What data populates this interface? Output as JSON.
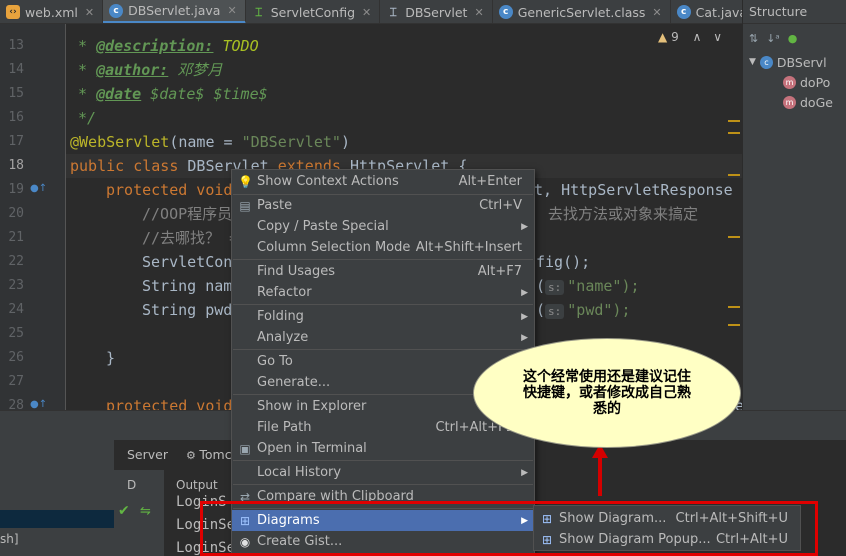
{
  "tabs": [
    {
      "label": "web.xml",
      "icon": "xml-file-icon"
    },
    {
      "label": "DBServlet.java",
      "icon": "java-class-icon",
      "active": true
    },
    {
      "label": "ServletConfig",
      "icon": "interface-icon"
    },
    {
      "label": "DBServlet",
      "icon": "class-icon"
    },
    {
      "label": "GenericServlet.class",
      "icon": "class-file-icon"
    },
    {
      "label": "Cat.java",
      "icon": "java-class-icon"
    }
  ],
  "structure": {
    "title": "Structure",
    "items": [
      "DBServl",
      "doPo",
      "doGe"
    ]
  },
  "editor": {
    "line_numbers": [
      "13",
      "14",
      "15",
      "16",
      "17",
      "18",
      "19",
      "20",
      "21",
      "22",
      "23",
      "24",
      "25",
      "26",
      "27",
      "28"
    ],
    "warnings": "9",
    "lines": {
      "l13_tag": "@description:",
      "l13_val": "TODO",
      "l14_tag": "@author:",
      "l14_val": "邓梦月",
      "l15_tag": "@date",
      "l15_val": "$date$ $time$",
      "l16": "*/",
      "l17_ann": "@WebServlet",
      "l17_rest": "(name = ",
      "l17_str": "\"DBServlet\"",
      "l17_end": ")",
      "l18_kw1": "public class ",
      "l18_id": "DBServlet ",
      "l18_kw2": "extends ",
      "l18_rest": "HttpServlet {",
      "l19_kw": "protected void",
      "l19_tail": "t, HttpServletResponse r",
      "l20": "//OOP程序员",
      "l20_tail": "去找方法或对象来搞定",
      "l21": "//去哪找？ =",
      "l22": "ServletCon",
      "l22_tail": "fig();",
      "l23": "String nam",
      "l23_hint": "s:",
      "l23_str": "\"name\");",
      "l24": "String pwd",
      "l24_hint": "s:",
      "l24_str": "\"pwd\");",
      "l26": "}",
      "l28_kw": "protected void",
      "l28_tail": "re"
    }
  },
  "bottom": {
    "server_tab": "Server",
    "tomcat_tab": "Tomc",
    "d_label": "D",
    "output_label": "Output",
    "output_lines": [
      "LoginS",
      "LoginSe",
      "LoginSe"
    ],
    "sh_text": "sh]"
  },
  "context_menu": {
    "items": [
      {
        "label": "Show Context Actions",
        "shortcut": "Alt+Enter",
        "icon": "lightbulb-icon"
      },
      {
        "label": "Paste",
        "shortcut": "Ctrl+V",
        "icon": "paste-icon"
      },
      {
        "label": "Copy / Paste Special",
        "arrow": true
      },
      {
        "label": "Column Selection Mode",
        "shortcut": "Alt+Shift+Insert"
      },
      {
        "label": "Find Usages",
        "shortcut": "Alt+F7"
      },
      {
        "label": "Refactor",
        "arrow": true
      },
      {
        "label": "Folding",
        "arrow": true
      },
      {
        "label": "Analyze",
        "arrow": true
      },
      {
        "label": "Go To",
        "arrow": true
      },
      {
        "label": "Generate...",
        "shortcut": "Al"
      },
      {
        "label": "Show in Explorer"
      },
      {
        "label": "File Path",
        "shortcut": "Ctrl+Alt+F12"
      },
      {
        "label": "Open in Terminal",
        "icon": "terminal-icon"
      },
      {
        "label": "Local History",
        "arrow": true
      },
      {
        "label": "Compare with Clipboard",
        "icon": "compare-icon"
      },
      {
        "label": "Diagrams",
        "arrow": true,
        "icon": "diagram-icon",
        "selected": true
      },
      {
        "label": "Create Gist...",
        "icon": "github-icon"
      }
    ]
  },
  "submenu": {
    "items": [
      {
        "label": "Show Diagram...",
        "shortcut": "Ctrl+Alt+Shift+U",
        "icon": "diagram-icon"
      },
      {
        "label": "Show Diagram Popup...",
        "shortcut": "Ctrl+Alt+U",
        "icon": "diagram-icon"
      }
    ]
  },
  "annotation": {
    "text": "这个经常使用还是建议记住快捷键，或者修改成自己熟悉的"
  },
  "colors": {
    "accent": "#4b6eaf",
    "annotation_red": "#e00000",
    "callout_bg": "#ffffc4"
  }
}
